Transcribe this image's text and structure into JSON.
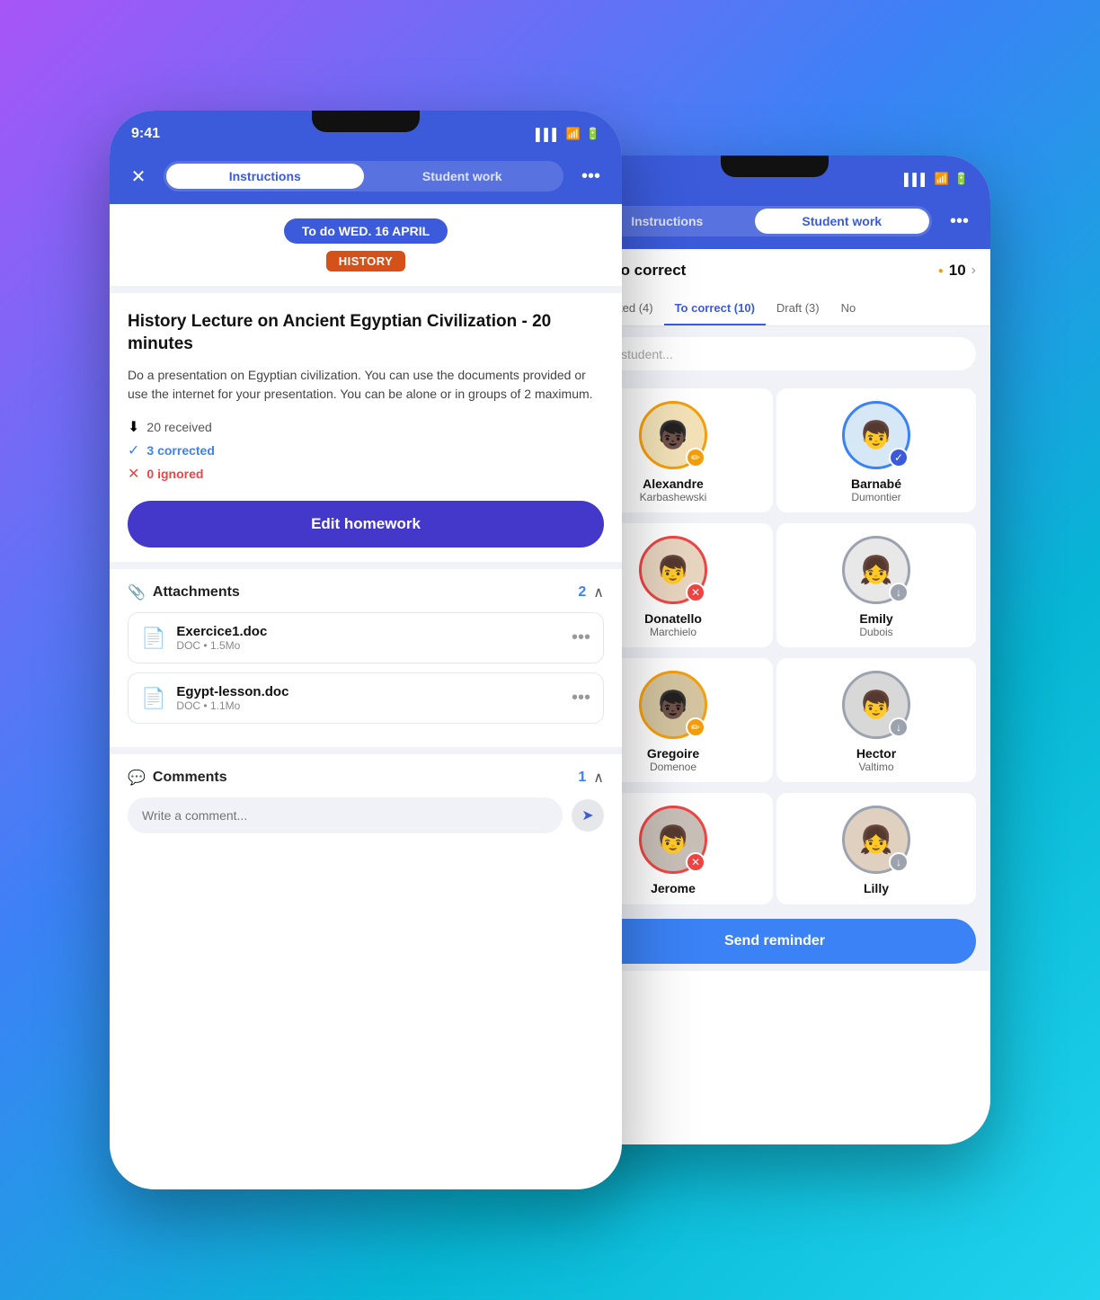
{
  "background": "linear-gradient(135deg, #a855f7 0%, #3b82f6 40%, #06b6d4 70%, #22d3ee 100%)",
  "left_phone": {
    "status": {
      "time": "9:41",
      "signal": "▌▌▌",
      "wifi": "wifi",
      "battery": "battery"
    },
    "nav": {
      "close_label": "✕",
      "tabs": [
        {
          "label": "Instructions",
          "active": true
        },
        {
          "label": "Student work",
          "active": false
        }
      ],
      "more_label": "•••"
    },
    "due_badge": "To do WED. 16 APRIL",
    "subject_badge": "HISTORY",
    "hw_title": "History Lecture on Ancient Egyptian Civilization - 20 minutes",
    "hw_desc": "Do a presentation on Egyptian civilization. You can use the documents provided or use the internet for your presentation. You can be alone or in groups of 2 maximum.",
    "stats": {
      "received": "20 received",
      "corrected": "3 corrected",
      "ignored": "0 ignored"
    },
    "edit_btn": "Edit homework",
    "attachments": {
      "label": "Attachments",
      "count": "2",
      "files": [
        {
          "name": "Exercice1.doc",
          "meta": "DOC • 1.5Mo"
        },
        {
          "name": "Egypt-lesson.doc",
          "meta": "DOC • 1.1Mo"
        }
      ]
    },
    "comments": {
      "label": "Comments",
      "count": "1",
      "placeholder": "Write a comment..."
    }
  },
  "right_phone": {
    "status": {
      "signal": "▌▌▌",
      "wifi": "wifi",
      "battery": "battery"
    },
    "nav": {
      "tabs": [
        {
          "label": "Instructions",
          "active": false
        },
        {
          "label": "Student work",
          "active": true
        }
      ],
      "more_label": "•••"
    },
    "work_header": {
      "title": "Work to correct",
      "count": "10"
    },
    "filter_tabs": [
      {
        "label": "Corrected (4)",
        "active": false
      },
      {
        "label": "To correct (10)",
        "active": true
      },
      {
        "label": "Draft (3)",
        "active": false
      },
      {
        "label": "No",
        "active": false
      }
    ],
    "search_placeholder": "a student...",
    "students": [
      {
        "first": "Alexandre",
        "last": "Karbashewski",
        "ring": "yellow",
        "badge": "orange",
        "badge_icon": "✏️"
      },
      {
        "first": "Barnabé",
        "last": "Dumontier",
        "ring": "blue",
        "badge": "blue",
        "badge_icon": "✓"
      },
      {
        "first": "Donatello",
        "last": "Marchielo",
        "ring": "red",
        "badge": "red",
        "badge_icon": "✕"
      },
      {
        "first": "Emily",
        "last": "Dubois",
        "ring": "gray",
        "badge": "gray",
        "badge_icon": "↓"
      },
      {
        "first": "Gregoire",
        "last": "Domenoe",
        "ring": "yellow",
        "badge": "orange",
        "badge_icon": "✏️"
      },
      {
        "first": "Hector",
        "last": "Valtimo",
        "ring": "gray",
        "badge": "gray",
        "badge_icon": "↓"
      },
      {
        "first": "Jerome",
        "last": "",
        "ring": "red",
        "badge": "red",
        "badge_icon": "✕"
      },
      {
        "first": "Lilly",
        "last": "",
        "ring": "gray",
        "badge": "gray",
        "badge_icon": "↓"
      }
    ],
    "send_reminder_btn": "Send reminder"
  }
}
